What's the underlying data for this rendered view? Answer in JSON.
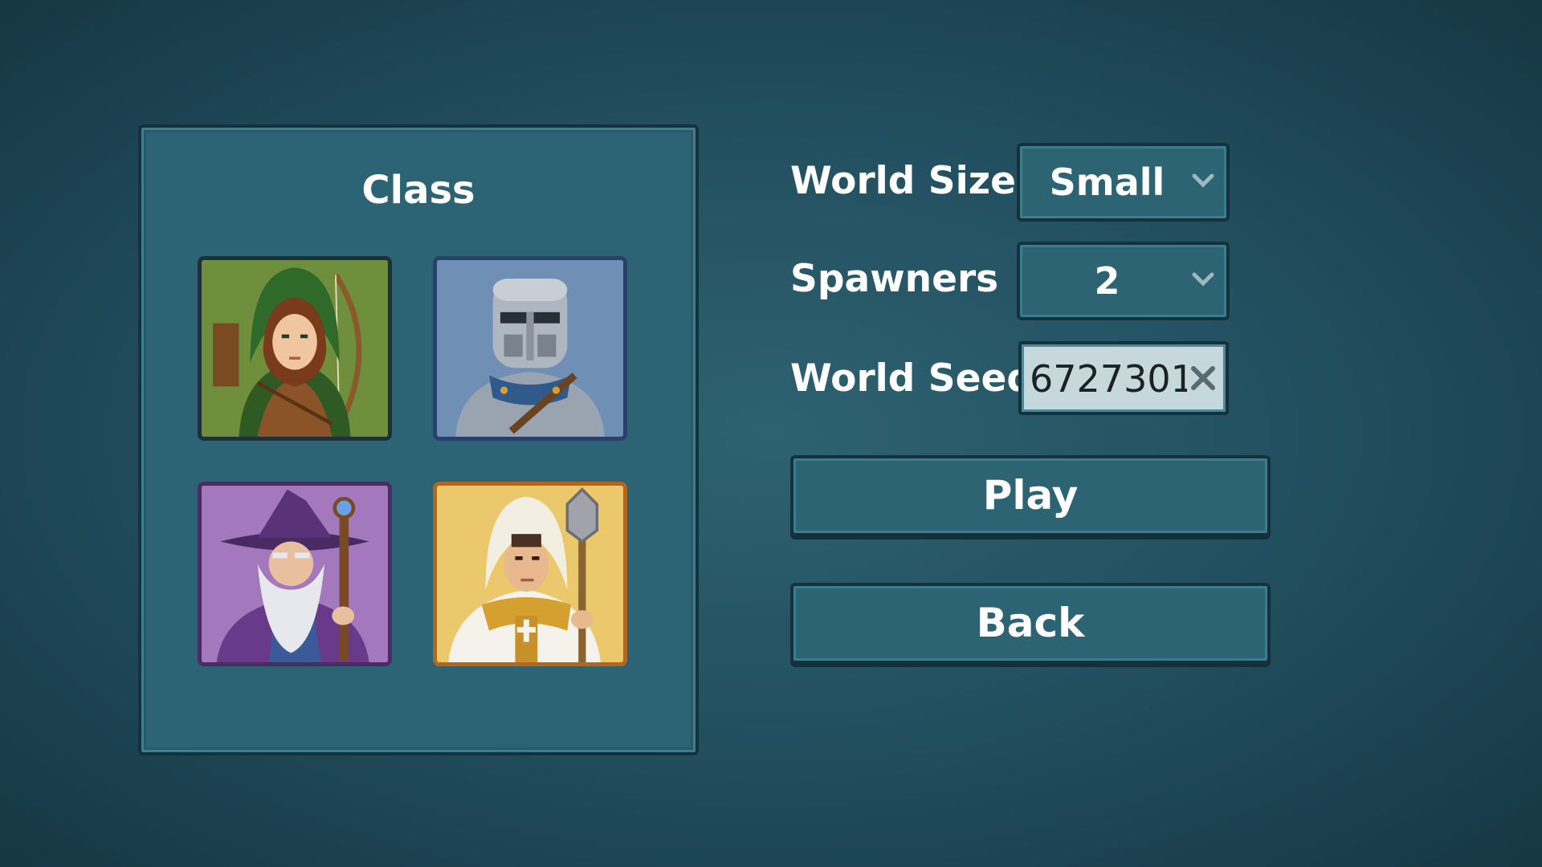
{
  "class_panel": {
    "title": "Class",
    "classes": [
      {
        "id": "ranger",
        "icon": "ranger-portrait-icon"
      },
      {
        "id": "knight",
        "icon": "knight-portrait-icon"
      },
      {
        "id": "wizard",
        "icon": "wizard-portrait-icon"
      },
      {
        "id": "cleric",
        "icon": "cleric-portrait-icon"
      }
    ]
  },
  "settings": {
    "world_size": {
      "label": "World Size",
      "value": "Small"
    },
    "spawners": {
      "label": "Spawners",
      "value": "2"
    },
    "world_seed": {
      "label": "World Seed",
      "value": "6727301"
    }
  },
  "buttons": {
    "play": "Play",
    "back": "Back"
  },
  "colors": {
    "background": "#235161",
    "panel": "#2d6475",
    "border": "#14313c",
    "text": "#ffffff",
    "seed_field": "#c6d8dc"
  }
}
